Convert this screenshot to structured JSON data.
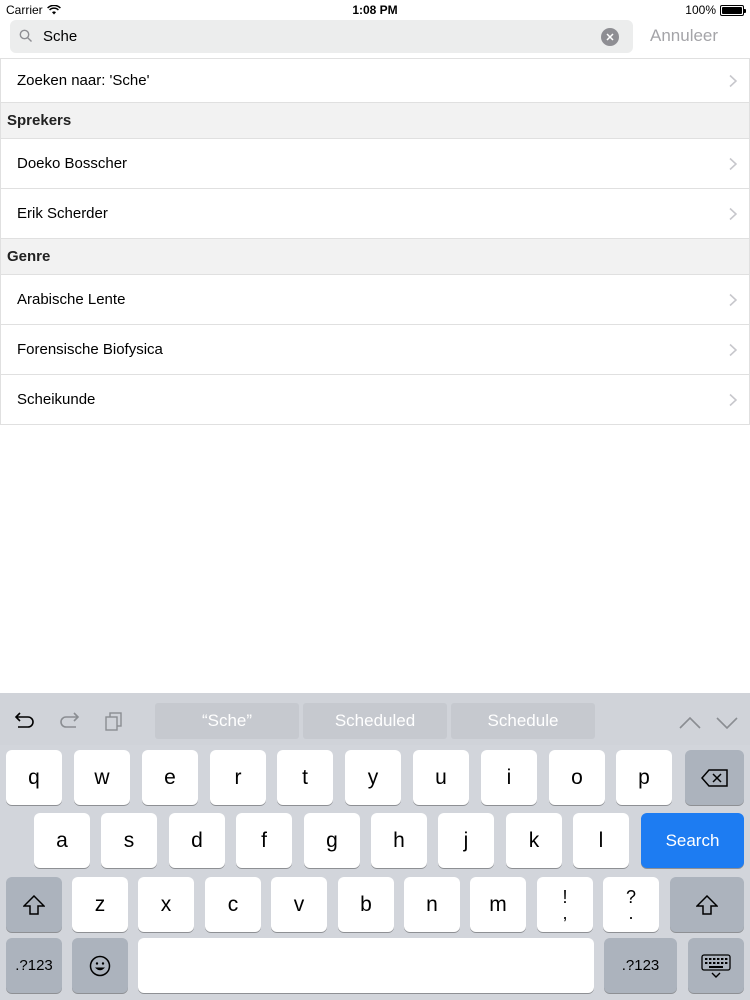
{
  "status_bar": {
    "carrier": "Carrier",
    "time": "1:08 PM",
    "battery": "100%"
  },
  "search": {
    "value": "Sche",
    "cancel_label": "Annuleer"
  },
  "results": {
    "search_for": "Zoeken naar: 'Sche'",
    "sections": [
      {
        "title": "Sprekers",
        "items": [
          "Doeko Bosscher",
          "Erik Scherder"
        ]
      },
      {
        "title": "Genre",
        "items": [
          "Arabische Lente",
          "Forensische Biofysica",
          "Scheikunde"
        ]
      }
    ]
  },
  "keyboard": {
    "suggestions": [
      "“Sche”",
      "Scheduled",
      "Schedule"
    ],
    "row1": [
      "q",
      "w",
      "e",
      "r",
      "t",
      "y",
      "u",
      "i",
      "o",
      "p"
    ],
    "row2": [
      "a",
      "s",
      "d",
      "f",
      "g",
      "h",
      "j",
      "k",
      "l"
    ],
    "row3": [
      "z",
      "x",
      "c",
      "v",
      "b",
      "n",
      "m"
    ],
    "exclaim_top": "!",
    "exclaim_bottom": ",",
    "question_top": "?",
    "question_bottom": ".",
    "search_label": "Search",
    "numbers_label": ".?123",
    "accent_color": "#1d7cf2"
  }
}
